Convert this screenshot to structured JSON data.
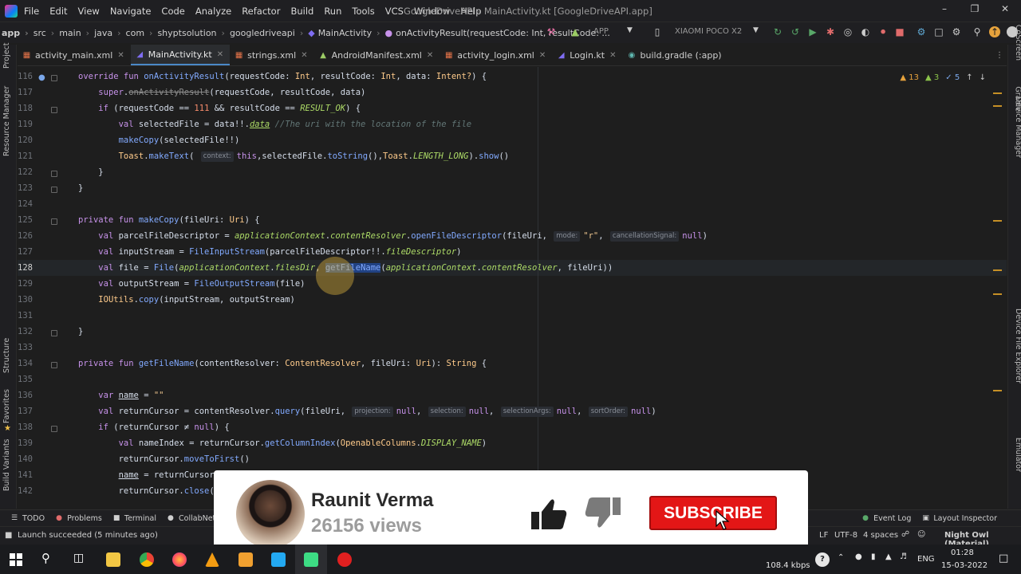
{
  "window": {
    "title": "GoogleDriveAPI - MainActivity.kt [GoogleDriveAPI.app]",
    "menu": [
      "File",
      "Edit",
      "View",
      "Navigate",
      "Code",
      "Analyze",
      "Refactor",
      "Build",
      "Run",
      "Tools",
      "VCS",
      "Window",
      "Help"
    ]
  },
  "breadcrumb": [
    "app",
    "src",
    "main",
    "java",
    "com",
    "shyptsolution",
    "googledriveapi",
    "MainActivity",
    "onActivityResult(requestCode: Int, resultCode: ..."
  ],
  "toolbar": {
    "run_config": "APP",
    "device": "XIAOMI POCO X2"
  },
  "tabs": [
    {
      "label": "activity_main.xml",
      "icon": "xml-icon",
      "color": "#e8754a"
    },
    {
      "label": "MainActivity.kt",
      "icon": "kotlin-icon",
      "color": "#7f6df2",
      "active": true
    },
    {
      "label": "strings.xml",
      "icon": "xml-icon",
      "color": "#e8754a"
    },
    {
      "label": "AndroidManifest.xml",
      "icon": "android-icon",
      "color": "#9ccc65"
    },
    {
      "label": "activity_login.xml",
      "icon": "xml-icon",
      "color": "#e8754a"
    },
    {
      "label": "Login.kt",
      "icon": "kotlin-icon",
      "color": "#7f6df2"
    },
    {
      "label": "build.gradle (:app)",
      "icon": "gradle-icon",
      "color": "#5fb8b0"
    }
  ],
  "left_panels": [
    "Project",
    "Resource Manager",
    "Structure",
    "Favorites",
    "Build Variants"
  ],
  "right_panels": [
    "CoScreen",
    "Gradle",
    "Device Manager",
    "Device File Explorer",
    "Emulator"
  ],
  "inspections": {
    "warnings": "13",
    "weak_warnings": "3",
    "typos": "5"
  },
  "editor": {
    "line_numbers": [
      "116",
      "117",
      "118",
      "119",
      "120",
      "121",
      "122",
      "123",
      "124",
      "125",
      "126",
      "127",
      "128",
      "129",
      "130",
      "131",
      "132",
      "133",
      "134",
      "135",
      "136",
      "137",
      "138",
      "139",
      "140",
      "141",
      "142"
    ],
    "current_line": "128",
    "hints": {
      "context": "context:",
      "mode": "mode:",
      "cancellation": "cancellationSignal:",
      "projection": "projection:",
      "selection": "selection:",
      "selectionArgs": "selectionArgs:",
      "sortOrder": "sortOrder:"
    },
    "comment": "//The uri with the location of the file"
  },
  "tool_windows": [
    "TODO",
    "Problems",
    "Terminal",
    "CollabNet",
    "Event Log",
    "Layout Inspector"
  ],
  "status": {
    "message": "Launch succeeded (5 minutes ago)",
    "line_sep": "LF",
    "encoding": "UTF-8",
    "indent": "4 spaces",
    "theme": "Night Owl (Material)"
  },
  "taskbar": {
    "net_speed": "108.4 kbps",
    "lang": "ENG",
    "time": "01:28",
    "date": "15-03-2022"
  },
  "overlay": {
    "channel_name": "Raunit Verma",
    "views": "26156 views",
    "subscribe_label": "SUBSCRIBE"
  }
}
